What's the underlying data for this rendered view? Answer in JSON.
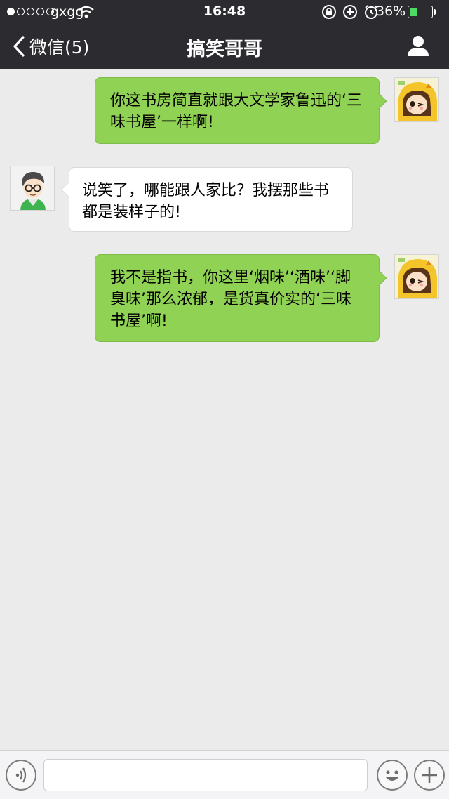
{
  "status_bar": {
    "carrier": "gxgg",
    "signal_bars_filled": 1,
    "signal_bars_total": 5,
    "time": "16:48",
    "battery_percent": "36%",
    "battery_level": 0.36,
    "icons": [
      "rotation-lock-icon",
      "alarm-icon"
    ]
  },
  "nav": {
    "back_label": "微信(5)",
    "title": "搞笑哥哥",
    "profile_icon": "person-icon"
  },
  "messages": [
    {
      "direction": "out",
      "avatar": "cartoon-girl-yellow-hood",
      "text": "你这书房简直就跟大文学家鲁迅的‘三味书屋’一样啊!"
    },
    {
      "direction": "in",
      "avatar": "cartoon-boy-glasses",
      "text": "说笑了，哪能跟人家比？我摆那些书都是装样子的!"
    },
    {
      "direction": "out",
      "avatar": "cartoon-girl-yellow-hood",
      "text": "我不是指书，你这里‘烟味’‘酒味’‘脚臭味’那么浓郁，是货真价实的‘三味书屋’啊!"
    }
  ],
  "input_bar": {
    "voice_icon": "voice-icon",
    "input_value": "",
    "emoji_icon": "emoji-icon",
    "plus_icon": "plus-icon"
  },
  "colors": {
    "nav_bg": "#2b2b30",
    "chat_bg": "#ebebeb",
    "outgoing_bubble": "#8fd254",
    "incoming_bubble": "#ffffff"
  }
}
